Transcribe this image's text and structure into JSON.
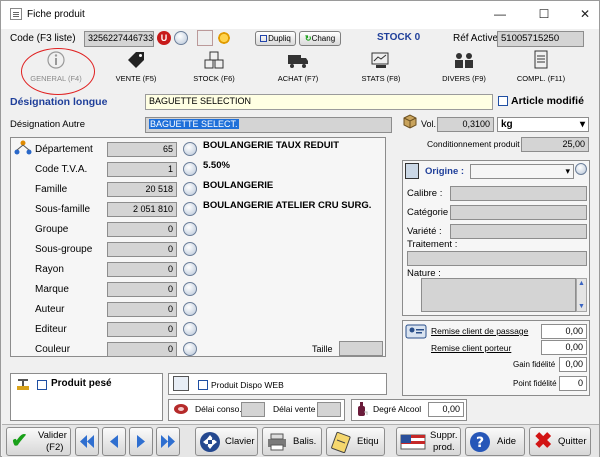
{
  "window": {
    "title": "Fiche produit",
    "minimize": "—",
    "maximize": "☐",
    "close": "✕"
  },
  "header": {
    "code_label": "Code (F3 liste)",
    "code_value": "3256227446733",
    "duplic": "Dupliq",
    "chang": "Chang",
    "stock": "STOCK 0",
    "ref_label": "Réf Active",
    "ref_value": "51005715250"
  },
  "tabs": [
    {
      "label": "GENERAL (F4)",
      "icon": "info-icon"
    },
    {
      "label": "VENTE (F5)",
      "icon": "price-tag-icon"
    },
    {
      "label": "STOCK (F6)",
      "icon": "boxes-icon"
    },
    {
      "label": "ACHAT (F7)",
      "icon": "truck-icon"
    },
    {
      "label": "STATS (F8)",
      "icon": "stats-icon"
    },
    {
      "label": "DIVERS (F9)",
      "icon": "people-icon"
    },
    {
      "label": "COMPL. (F11)",
      "icon": "document-icon"
    }
  ],
  "designation": {
    "longue_label": "Désignation longue",
    "longue_value": "BAGUETTE SELECTION",
    "article_modifie": "Article modifié",
    "autre_label": "Désignation Autre",
    "autre_value": "BAGUETTE SELECT."
  },
  "classification": {
    "rows": [
      {
        "label": "Département",
        "value": "65",
        "desc": "BOULANGERIE TAUX REDUIT"
      },
      {
        "label": "Code T.V.A.",
        "value": "1",
        "desc": "5.50%"
      },
      {
        "label": "Famille",
        "value": "20 518",
        "desc": "BOULANGERIE"
      },
      {
        "label": "Sous-famille",
        "value": "2 051 810",
        "desc": "BOULANGERIE ATELIER CRU SURG."
      },
      {
        "label": "Groupe",
        "value": "0",
        "desc": ""
      },
      {
        "label": "Sous-groupe",
        "value": "0",
        "desc": ""
      },
      {
        "label": "Rayon",
        "value": "0",
        "desc": ""
      },
      {
        "label": "Marque",
        "value": "0",
        "desc": ""
      },
      {
        "label": "Auteur",
        "value": "0",
        "desc": ""
      },
      {
        "label": "Editeur",
        "value": "0",
        "desc": ""
      },
      {
        "label": "Couleur",
        "value": "0",
        "desc": ""
      }
    ],
    "taille_label": "Taille",
    "taille_value": ""
  },
  "volume": {
    "vol_label": "Vol.",
    "vol_value": "0,3100",
    "unit": "kg",
    "cond_label": "Conditionnement produit",
    "cond_value": "25,00"
  },
  "origine": {
    "label": "Origine :",
    "value": "",
    "fields": [
      {
        "label": "Calibre :",
        "value": ""
      },
      {
        "label": "Catégorie :",
        "value": ""
      },
      {
        "label": "Variété :",
        "value": ""
      },
      {
        "label": "Traitement :",
        "value": ""
      },
      {
        "label": "Nature :",
        "value": ""
      }
    ]
  },
  "remises": {
    "passage_label": "Remise client de passage",
    "passage_value": "0,00",
    "porteur_label": "Remise client porteur",
    "porteur_value": "0,00",
    "gain_label": "Gain fidélité",
    "gain_value": "0,00",
    "point_label": "Point fidélité",
    "point_value": "0"
  },
  "produit_pese": "Produit pesé",
  "web": "Produit Dispo WEB",
  "delais": {
    "conso_label": "Délai conso.",
    "conso_value": "",
    "vente_label": "Délai vente",
    "vente_value": ""
  },
  "alcool": {
    "label": "Degré Alcool",
    "value": "0,00"
  },
  "bottom": {
    "valider": "Valider",
    "valider_key": "(F2)",
    "clavier": "Clavier",
    "balis": "Balis.",
    "etiqu": "Etiqu",
    "suppr": "Suppr.",
    "prod": "prod.",
    "aide": "Aide",
    "quitter": "Quitter"
  },
  "colors": {
    "accent_blue": "#1f3f9a",
    "selection": "#1e6fd9",
    "highlight_circle": "#e02020",
    "green_check": "#19a019",
    "red_x": "#d21414"
  }
}
